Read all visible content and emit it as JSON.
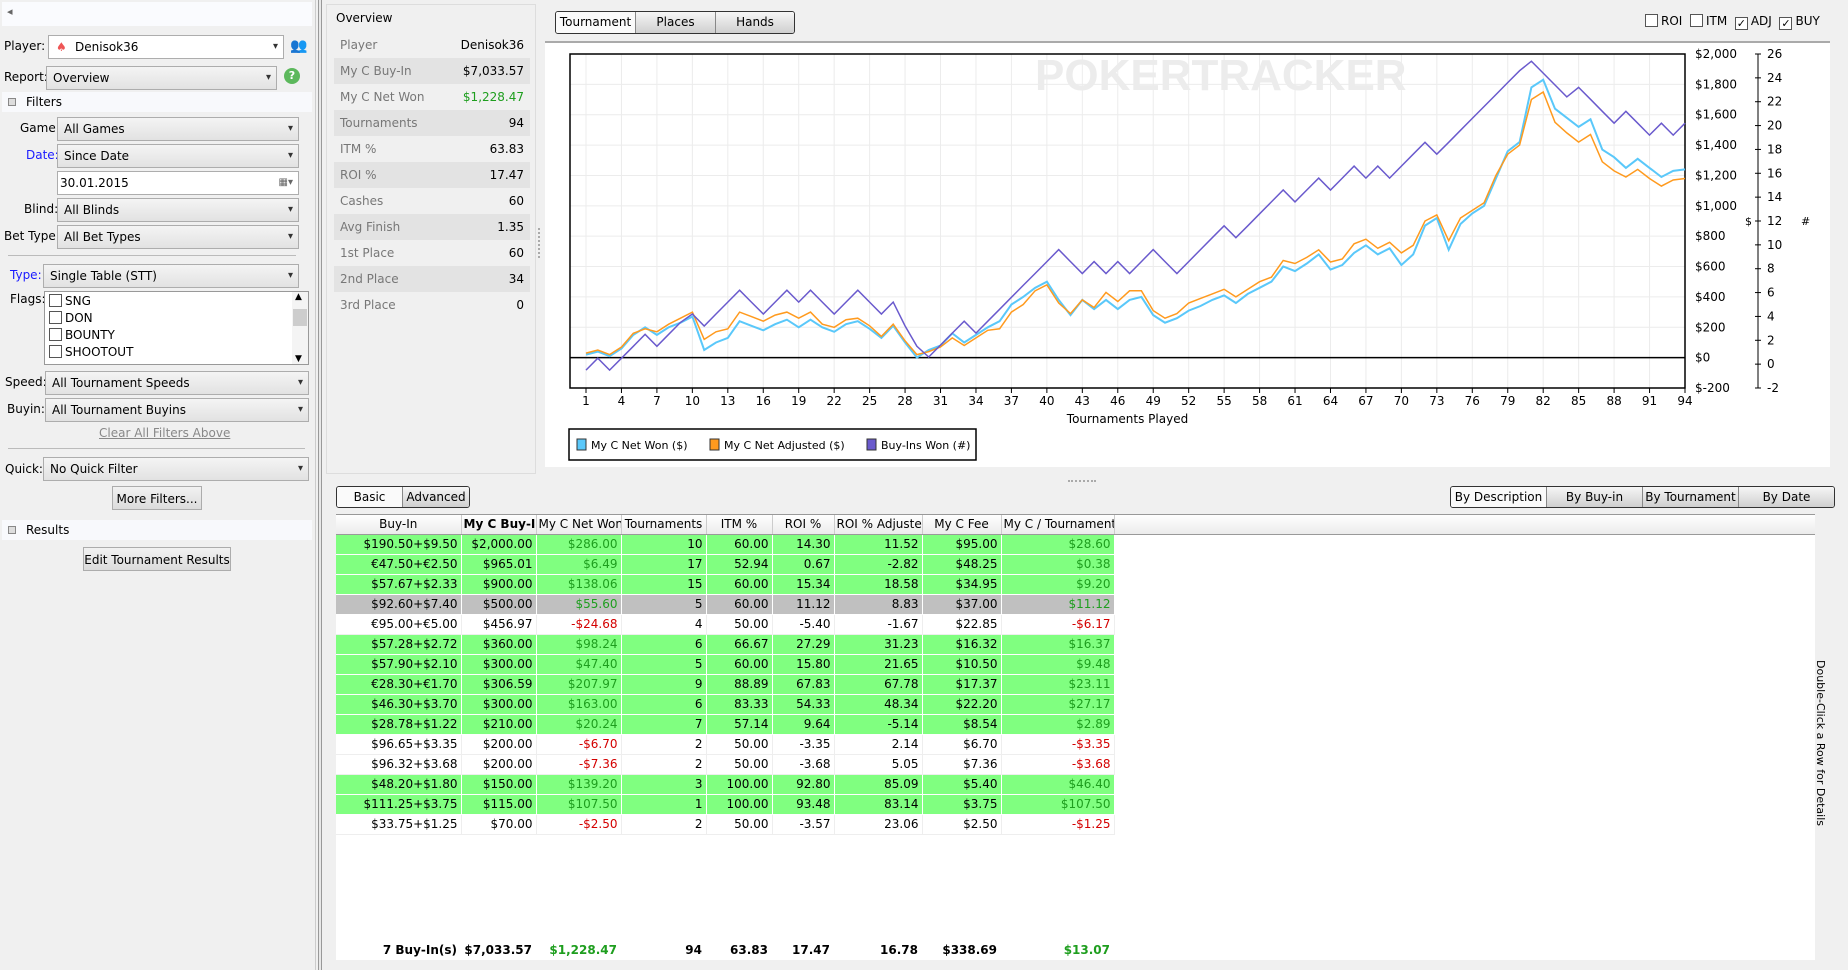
{
  "sidebar": {
    "collapse_glyph": "◂",
    "player_label": "Player:",
    "player_value": "Denisok36",
    "report_label": "Report:",
    "report_value": "Overview",
    "filters_title": "Filters",
    "game_label": "Game:",
    "game_value": "All Games",
    "date_label": "Date:",
    "date_value": "Since Date",
    "date_input": "30.01.2015",
    "blind_label": "Blind:",
    "blind_value": "All Blinds",
    "bettype_label": "Bet Type:",
    "bettype_value": "All Bet Types",
    "type_label": "Type:",
    "type_value": "Single Table (STT)",
    "flags_label": "Flags:",
    "flags": [
      {
        "label": "SNG",
        "checked": false
      },
      {
        "label": "DON",
        "checked": false
      },
      {
        "label": "BOUNTY",
        "checked": false
      },
      {
        "label": "SHOOTOUT",
        "checked": false
      }
    ],
    "speed_label": "Speed:",
    "speed_value": "All Tournament Speeds",
    "buyin_label": "Buyin:",
    "buyin_value": "All Tournament Buyins",
    "clear_link": "Clear All Filters Above",
    "quick_label": "Quick:",
    "quick_value": "No Quick Filter",
    "more_filters": "More Filters...",
    "results_title": "Results",
    "edit_results": "Edit Tournament Results"
  },
  "overview": {
    "title": "Overview",
    "rows": [
      {
        "label": "Player",
        "value": "Denisok36"
      },
      {
        "label": "My C Buy-In",
        "value": "$7,033.57"
      },
      {
        "label": "My C Net Won",
        "value": "$1,228.47",
        "color": "#1e9e1e"
      },
      {
        "label": "Tournaments",
        "value": "94"
      },
      {
        "label": "ITM %",
        "value": "63.83"
      },
      {
        "label": "ROI %",
        "value": "17.47"
      },
      {
        "label": "Cashes",
        "value": "60"
      },
      {
        "label": "Avg Finish",
        "value": "1.35"
      },
      {
        "label": "1st Place",
        "value": "60"
      },
      {
        "label": "2nd Place",
        "value": "34"
      },
      {
        "label": "3rd Place",
        "value": "0"
      }
    ]
  },
  "chart_tabs": [
    "Tournament",
    "Places",
    "Hands"
  ],
  "chart_toggles": [
    {
      "label": "ROI",
      "checked": false
    },
    {
      "label": "ITM",
      "checked": false
    },
    {
      "label": "ADJ",
      "checked": true
    },
    {
      "label": "BUY",
      "checked": true
    }
  ],
  "chart_data": {
    "type": "line",
    "watermark": "POKERTRACKER",
    "xlabel": "Tournaments Played",
    "ylabel_left": "$",
    "ylabel_right": "#",
    "x_ticks": [
      1,
      4,
      7,
      10,
      13,
      16,
      19,
      22,
      25,
      28,
      31,
      34,
      37,
      40,
      43,
      46,
      49,
      52,
      55,
      58,
      61,
      64,
      67,
      70,
      73,
      76,
      79,
      82,
      85,
      88,
      91,
      94
    ],
    "xlim": [
      1,
      94
    ],
    "ylim_dollar": [
      -200,
      2000
    ],
    "y_ticks_dollar": [
      "$-200",
      "$0",
      "$200",
      "$400",
      "$600",
      "$800",
      "$1,000",
      "$1,200",
      "$1,400",
      "$1,600",
      "$1,800",
      "$2,000"
    ],
    "ylim_count": [
      -2,
      26
    ],
    "y_ticks_count": [
      "-2",
      "0",
      "2",
      "4",
      "6",
      "8",
      "10",
      "12",
      "14",
      "16",
      "18",
      "20",
      "22",
      "24",
      "26"
    ],
    "legend_position": "bottom-left",
    "series": [
      {
        "name": "My C Net Won ($)",
        "axis": "dollar",
        "color": "#5ac8fa",
        "values": [
          20,
          40,
          10,
          60,
          150,
          200,
          150,
          200,
          230,
          270,
          50,
          100,
          130,
          240,
          210,
          180,
          220,
          250,
          200,
          250,
          200,
          170,
          220,
          240,
          190,
          130,
          210,
          100,
          0,
          50,
          80,
          160,
          100,
          150,
          200,
          240,
          350,
          400,
          460,
          500,
          380,
          280,
          380,
          320,
          380,
          320,
          380,
          400,
          280,
          230,
          260,
          310,
          340,
          380,
          410,
          360,
          420,
          460,
          500,
          600,
          570,
          620,
          680,
          580,
          610,
          690,
          740,
          680,
          720,
          610,
          680,
          870,
          920,
          710,
          880,
          950,
          1000,
          1180,
          1360,
          1420,
          1780,
          1830,
          1640,
          1580,
          1520,
          1570,
          1370,
          1320,
          1250,
          1310,
          1250,
          1190,
          1230,
          1240
        ]
      },
      {
        "name": "My C Net Adjusted ($)",
        "axis": "dollar",
        "color": "#ff9a1e",
        "values": [
          30,
          50,
          20,
          70,
          160,
          190,
          170,
          220,
          260,
          300,
          120,
          170,
          190,
          300,
          270,
          240,
          280,
          300,
          260,
          300,
          220,
          200,
          250,
          260,
          210,
          140,
          220,
          110,
          20,
          40,
          70,
          130,
          80,
          130,
          180,
          190,
          300,
          350,
          440,
          480,
          360,
          290,
          380,
          330,
          430,
          370,
          440,
          440,
          310,
          260,
          290,
          360,
          390,
          420,
          450,
          400,
          450,
          500,
          530,
          640,
          620,
          660,
          710,
          630,
          650,
          750,
          780,
          720,
          760,
          690,
          740,
          900,
          940,
          770,
          920,
          970,
          1020,
          1200,
          1340,
          1400,
          1700,
          1750,
          1550,
          1480,
          1420,
          1470,
          1290,
          1230,
          1190,
          1240,
          1180,
          1130,
          1170,
          1180
        ]
      },
      {
        "name": "Buy-Ins Won (#)",
        "axis": "count",
        "color": "#6a5acd",
        "values": [
          -0.5,
          0.5,
          -0.5,
          0.5,
          1.5,
          2.5,
          1.5,
          2.5,
          3.5,
          4.2,
          3.2,
          4.2,
          5.2,
          6.2,
          5.2,
          4.2,
          5.2,
          6.2,
          5.2,
          6.2,
          5.2,
          4.2,
          5.2,
          6.2,
          5.2,
          4.2,
          5.2,
          3.2,
          1.5,
          0.6,
          1.6,
          2.6,
          3.6,
          2.6,
          3.6,
          4.6,
          5.6,
          6.6,
          7.6,
          8.6,
          9.6,
          8.6,
          7.6,
          8.6,
          7.6,
          8.6,
          7.6,
          8.6,
          9.6,
          8.6,
          7.6,
          8.6,
          9.6,
          10.6,
          11.6,
          10.6,
          11.6,
          12.6,
          13.6,
          14.6,
          13.6,
          14.6,
          15.6,
          14.6,
          15.6,
          16.6,
          15.6,
          16.6,
          15.6,
          16.6,
          17.6,
          18.6,
          17.6,
          18.6,
          19.6,
          20.6,
          21.6,
          22.6,
          23.6,
          24.6,
          25.4,
          24.4,
          23.4,
          22.4,
          23.2,
          22.2,
          21.2,
          20.2,
          21.2,
          20.2,
          19.2,
          20.2,
          19.2,
          20.2
        ]
      }
    ]
  },
  "bottom_tabs": [
    "Basic",
    "Advanced"
  ],
  "group_tabs": [
    "By Description",
    "By Buy-in",
    "By Tournament",
    "By Date"
  ],
  "side_hint": "Double-Click a Row for Details",
  "table": {
    "columns": [
      "Buy-In",
      "My C Buy-In",
      "My C Net Won",
      "Tournaments",
      "ITM %",
      "ROI %",
      "ROI % Adjusted",
      "My C Fee",
      "My C / Tournament"
    ],
    "rows": [
      {
        "state": "green",
        "cells": [
          "$190.50+$9.50",
          "$2,000.00",
          "$286.00",
          "10",
          "60.00",
          "14.30",
          "11.52",
          "$95.00",
          "$28.60"
        ]
      },
      {
        "state": "green",
        "cells": [
          "€47.50+€2.50",
          "$965.01",
          "$6.49",
          "17",
          "52.94",
          "0.67",
          "-2.82",
          "$48.25",
          "$0.38"
        ]
      },
      {
        "state": "green",
        "cells": [
          "$57.67+$2.33",
          "$900.00",
          "$138.06",
          "15",
          "60.00",
          "15.34",
          "18.58",
          "$34.95",
          "$9.20"
        ]
      },
      {
        "state": "selected",
        "cells": [
          "$92.60+$7.40",
          "$500.00",
          "$55.60",
          "5",
          "60.00",
          "11.12",
          "8.83",
          "$37.00",
          "$11.12"
        ]
      },
      {
        "state": "white",
        "cells": [
          "€95.00+€5.00",
          "$456.97",
          "-$24.68",
          "4",
          "50.00",
          "-5.40",
          "-1.67",
          "$22.85",
          "-$6.17"
        ]
      },
      {
        "state": "green",
        "cells": [
          "$57.28+$2.72",
          "$360.00",
          "$98.24",
          "6",
          "66.67",
          "27.29",
          "31.23",
          "$16.32",
          "$16.37"
        ]
      },
      {
        "state": "green",
        "cells": [
          "$57.90+$2.10",
          "$300.00",
          "$47.40",
          "5",
          "60.00",
          "15.80",
          "21.65",
          "$10.50",
          "$9.48"
        ]
      },
      {
        "state": "green",
        "cells": [
          "€28.30+€1.70",
          "$306.59",
          "$207.97",
          "9",
          "88.89",
          "67.83",
          "67.78",
          "$17.37",
          "$23.11"
        ]
      },
      {
        "state": "green",
        "cells": [
          "$46.30+$3.70",
          "$300.00",
          "$163.00",
          "6",
          "83.33",
          "54.33",
          "48.34",
          "$22.20",
          "$27.17"
        ]
      },
      {
        "state": "green",
        "cells": [
          "$28.78+$1.22",
          "$210.00",
          "$20.24",
          "7",
          "57.14",
          "9.64",
          "-5.14",
          "$8.54",
          "$2.89"
        ]
      },
      {
        "state": "white",
        "cells": [
          "$96.65+$3.35",
          "$200.00",
          "-$6.70",
          "2",
          "50.00",
          "-3.35",
          "2.14",
          "$6.70",
          "-$3.35"
        ]
      },
      {
        "state": "white",
        "cells": [
          "$96.32+$3.68",
          "$200.00",
          "-$7.36",
          "2",
          "50.00",
          "-3.68",
          "5.05",
          "$7.36",
          "-$3.68"
        ]
      },
      {
        "state": "green",
        "cells": [
          "$48.20+$1.80",
          "$150.00",
          "$139.20",
          "3",
          "100.00",
          "92.80",
          "85.09",
          "$5.40",
          "$46.40"
        ]
      },
      {
        "state": "green",
        "cells": [
          "$111.25+$3.75",
          "$115.00",
          "$107.50",
          "1",
          "100.00",
          "93.48",
          "83.14",
          "$3.75",
          "$107.50"
        ]
      },
      {
        "state": "white",
        "cells": [
          "$33.75+$1.25",
          "$70.00",
          "-$2.50",
          "2",
          "50.00",
          "-3.57",
          "23.06",
          "$2.50",
          "-$1.25"
        ]
      }
    ],
    "totals": [
      "7 Buy-In(s)",
      "$7,033.57",
      "$1,228.47",
      "94",
      "63.83",
      "17.47",
      "16.78",
      "$338.69",
      "$13.07"
    ]
  }
}
